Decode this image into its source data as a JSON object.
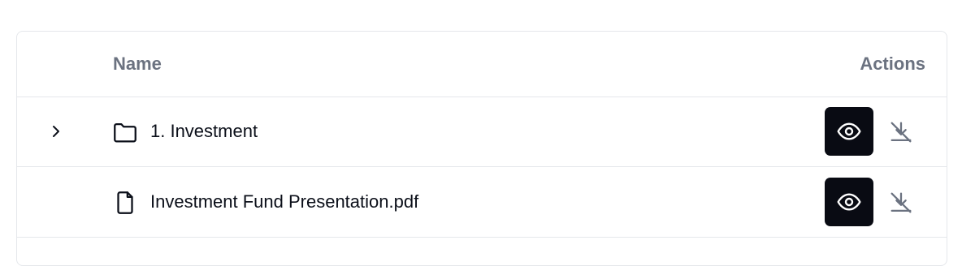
{
  "table": {
    "columns": {
      "name": "Name",
      "actions": "Actions"
    },
    "rows": [
      {
        "type": "folder",
        "name": "1. Investment",
        "expand_icon": "chevron-right-icon",
        "icon": "folder-icon",
        "actions": [
          "view-icon",
          "download-off-icon"
        ]
      },
      {
        "type": "file",
        "name": "Investment Fund Presentation.pdf",
        "icon": "file-icon",
        "actions": [
          "view-icon",
          "download-off-icon"
        ]
      }
    ]
  },
  "colors": {
    "view_button_bg": "#090b13",
    "header_text": "#6b7280",
    "border": "#e5e7eb",
    "disabled_icon": "#6b7280"
  }
}
